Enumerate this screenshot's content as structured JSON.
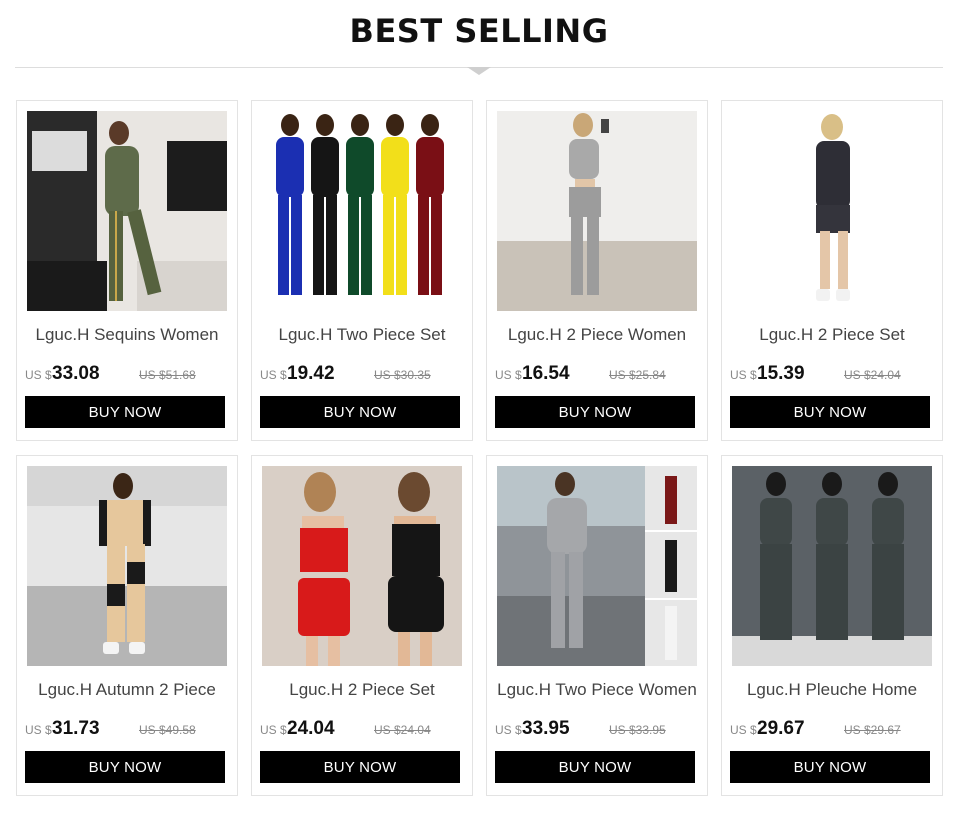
{
  "section": {
    "title": "BEST SELLING"
  },
  "products": [
    {
      "name": "Lguc.H Sequins Women",
      "currency": "US $",
      "price": "33.08",
      "old_price": "US $51.68",
      "button": "BUY NOW"
    },
    {
      "name": "Lguc.H Two Piece Set",
      "currency": "US $",
      "price": "19.42",
      "old_price": "US $30.35",
      "button": "BUY NOW"
    },
    {
      "name": "Lguc.H 2 Piece Women",
      "currency": "US $",
      "price": "16.54",
      "old_price": "US $25.84",
      "button": "BUY NOW"
    },
    {
      "name": "Lguc.H 2 Piece Set",
      "currency": "US $",
      "price": "15.39",
      "old_price": "US $24.04",
      "button": "BUY NOW"
    },
    {
      "name": "Lguc.H Autumn 2 Piece",
      "currency": "US $",
      "price": "31.73",
      "old_price": "US $49.58",
      "button": "BUY NOW"
    },
    {
      "name": "Lguc.H 2 Piece Set",
      "currency": "US $",
      "price": "24.04",
      "old_price": "US $24.04",
      "button": "BUY NOW"
    },
    {
      "name": "Lguc.H Two Piece Women",
      "currency": "US $",
      "price": "33.95",
      "old_price": "US $33.95",
      "button": "BUY NOW"
    },
    {
      "name": "Lguc.H Pleuche Home",
      "currency": "US $",
      "price": "29.67",
      "old_price": "US $29.67",
      "button": "BUY NOW"
    }
  ],
  "colors": {
    "button_bg": "#000000",
    "button_text": "#ffffff",
    "divider": "#dddddd"
  }
}
